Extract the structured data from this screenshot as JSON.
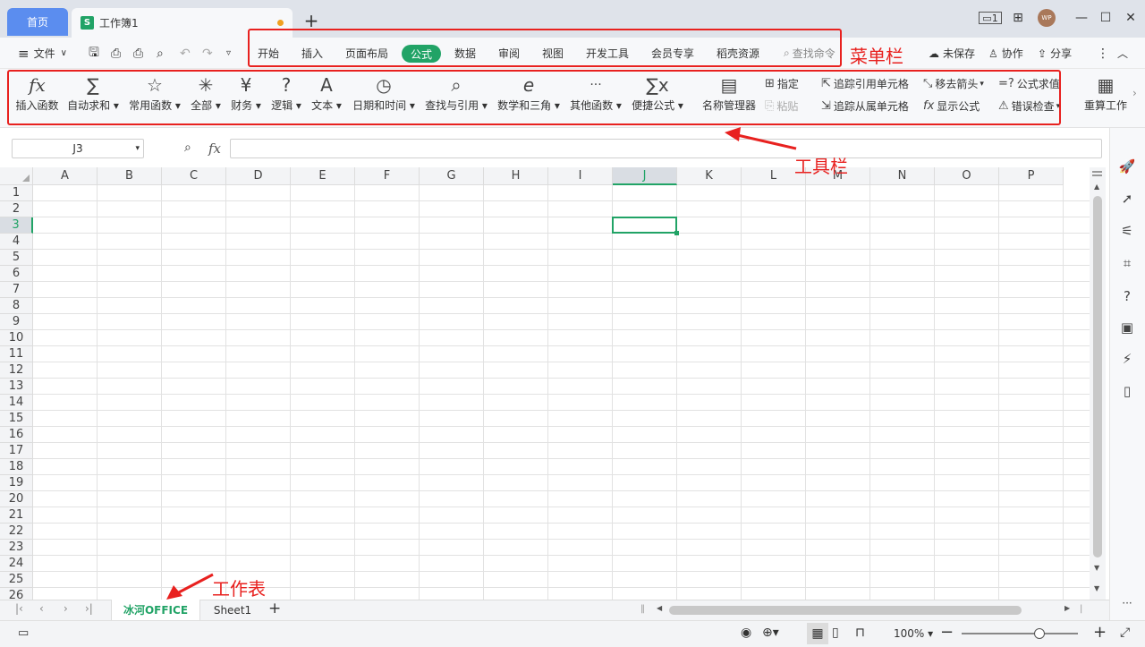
{
  "titlebar": {
    "home_tab": "首页",
    "doc_tab": "工作簿1",
    "doc_icon": "S",
    "add_tab": "+",
    "avatar": "WP",
    "controls": [
      "▭1",
      "⊞",
      "—",
      "☐",
      "✕"
    ]
  },
  "menubar": {
    "file_label": "文件",
    "tabs": [
      "开始",
      "插入",
      "页面布局",
      "公式",
      "数据",
      "审阅",
      "视图",
      "开发工具",
      "会员专享",
      "稻壳资源"
    ],
    "active_tab": "公式",
    "search_placeholder": "查找命令",
    "right": [
      "未保存",
      "协作",
      "分享"
    ]
  },
  "toolbar": {
    "big_buttons": [
      {
        "label": "插入函数",
        "icon": "fx"
      },
      {
        "label": "自动求和",
        "icon": "∑"
      },
      {
        "label": "常用函数",
        "icon": "☆"
      },
      {
        "label": "全部",
        "icon": "✳"
      },
      {
        "label": "财务",
        "icon": "¥"
      },
      {
        "label": "逻辑",
        "icon": "?"
      },
      {
        "label": "文本",
        "icon": "A"
      },
      {
        "label": "日期和时间",
        "icon": "◷"
      },
      {
        "label": "查找与引用",
        "icon": "⌕"
      },
      {
        "label": "数学和三角",
        "icon": "e"
      },
      {
        "label": "其他函数",
        "icon": "···"
      },
      {
        "label": "便捷公式",
        "icon": "∑x"
      },
      {
        "label": "名称管理器",
        "icon": "▤"
      }
    ],
    "assign": "指定",
    "paste": "粘贴",
    "trace_precedents": "追踪引用单元格",
    "trace_dependents": "追踪从属单元格",
    "remove_arrows": "移去箭头",
    "show_formulas": "显示公式",
    "evaluate_formula": "公式求值",
    "error_check": "错误检查",
    "recalc": "重算工作"
  },
  "formula_bar": {
    "name_box": "J3",
    "fx": "fx",
    "content": ""
  },
  "grid": {
    "columns": [
      "A",
      "B",
      "C",
      "D",
      "E",
      "F",
      "G",
      "H",
      "I",
      "J",
      "K",
      "L",
      "M",
      "N",
      "O",
      "P"
    ],
    "rows": [
      "1",
      "2",
      "3",
      "4",
      "5",
      "6",
      "7",
      "8",
      "9",
      "10",
      "11",
      "12",
      "13",
      "14",
      "15",
      "16",
      "17",
      "18",
      "19",
      "20",
      "21",
      "22",
      "23",
      "24",
      "25",
      "26"
    ],
    "selected_cell": "J3"
  },
  "sheets": {
    "tabs": [
      "冰河OFFICE",
      "Sheet1"
    ],
    "active": "冰河OFFICE"
  },
  "status": {
    "zoom": "100%"
  },
  "annotations": {
    "menu": "菜单栏",
    "toolbar": "工具栏",
    "sheet": "工作表"
  },
  "colors": {
    "accent": "#21a366",
    "annotation_red": "#e8211f",
    "home_tab_blue": "#5b8def"
  }
}
